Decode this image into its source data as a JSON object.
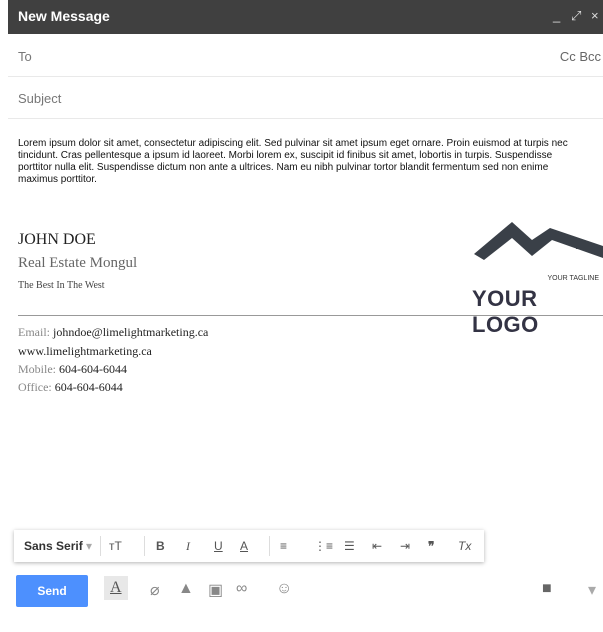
{
  "window": {
    "title": "New Message",
    "minimize": "_",
    "expand": "⤢",
    "close": "×"
  },
  "compose": {
    "to_label": "To",
    "cc_bcc": "Cc Bcc",
    "subject_label": "Subject",
    "body": "Lorem ipsum dolor sit amet, consectetur adipiscing elit. Sed pulvinar sit amet ipsum eget ornare. Proin euismod at turpis nec tincidunt. Cras pellentesque a ipsum id laoreet. Morbi lorem ex, suscipit id finibus sit amet, lobortis in turpis. Suspendisse porttitor nulla elit. Suspendisse dictum non ante a ultrices. Nam eu nibh pulvinar tortor blandit fermentum sed non enime maximus porttitor."
  },
  "signature": {
    "name": "JOHN DOE",
    "title": "Real Estate Mongul",
    "tagline": "The Best In The West",
    "logo_tagline": "YOUR TAGLINE",
    "logo_text": "YOUR LOGO",
    "email_label": "Email:",
    "email": "johndoe@limelightmarketing.ca",
    "website": "www.limelightmarketing.ca",
    "mobile_label": "Mobile:",
    "mobile": "604-604-6044",
    "office_label": "Office:",
    "office": "604-604-6044"
  },
  "format_toolbar": {
    "font": "Sans Serif",
    "size": "тT",
    "bold": "B",
    "italic": "I",
    "underline": "U",
    "text_color": "A",
    "align": "≡",
    "numbered": "⋮≡",
    "bulleted": "☰",
    "indent_less": "⇤",
    "indent_more": "⇥",
    "quote": "❞",
    "clear": "Tx"
  },
  "bottom_toolbar": {
    "send": "Send",
    "format": "A"
  },
  "colors": {
    "titlebar": "#404040",
    "send": "#4d90fe",
    "logo": "#334"
  }
}
